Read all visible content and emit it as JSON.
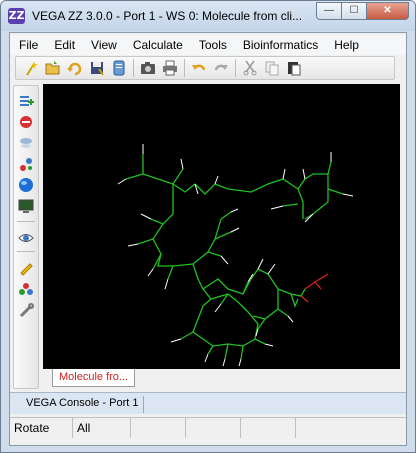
{
  "window": {
    "app_logo": "ZZ",
    "title": "VEGA ZZ 3.0.0 - Port 1 - WS 0: Molecule from cli..."
  },
  "window_buttons": {
    "minimize": "—",
    "maximize": "☐",
    "close": "✕"
  },
  "menu": [
    "File",
    "Edit",
    "View",
    "Calculate",
    "Tools",
    "Bioinformatics",
    "Help"
  ],
  "toolbar_icons": [
    "wizard-icon",
    "open-folder-icon",
    "undo-open-icon",
    "save-icon",
    "document-icon",
    "camera-icon",
    "print-icon",
    "undo-icon",
    "redo-icon",
    "cut-icon",
    "copy-icon",
    "paste-icon"
  ],
  "left_toolbar_icons": [
    "select-atoms-icon",
    "remove-icon",
    "hydrogens-icon",
    "graph-icon",
    "globe-icon",
    "monitor-icon",
    "eye-icon",
    "pencil-icon",
    "molecule-icon",
    "tools-icon"
  ],
  "document_tab": "Molecule fro...",
  "console_tab": "VEGA Console - Port 1",
  "status": {
    "mode": "Rotate",
    "selection": "All"
  },
  "colors": {
    "viewport_bg": "#000000",
    "bond": "#20c020",
    "hydrogen": "#ffffff",
    "oxygen": "#e02020",
    "accent_tab_text": "#d42020"
  }
}
